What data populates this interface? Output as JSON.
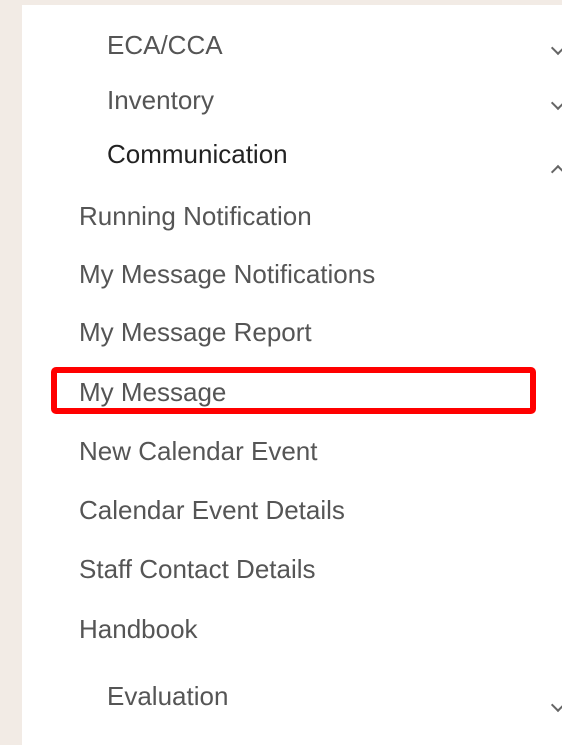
{
  "menu": {
    "groups": [
      {
        "label": "ECA/CCA",
        "expanded": false,
        "icon": "chevron-down-icon"
      },
      {
        "label": "Inventory",
        "expanded": false,
        "icon": "chevron-down-icon"
      },
      {
        "label": "Communication",
        "expanded": true,
        "icon": "chevron-up-icon"
      },
      {
        "label": "Evaluation",
        "expanded": false,
        "icon": "chevron-down-icon"
      }
    ],
    "communication_items": [
      "Running Notification",
      "My Message Notifications",
      "My Message Report",
      "My Message",
      "New Calendar Event",
      "Calendar Event Details",
      "Staff Contact Details",
      "Handbook"
    ],
    "highlighted_item": "My Message",
    "highlight_color": "#ff0000"
  }
}
